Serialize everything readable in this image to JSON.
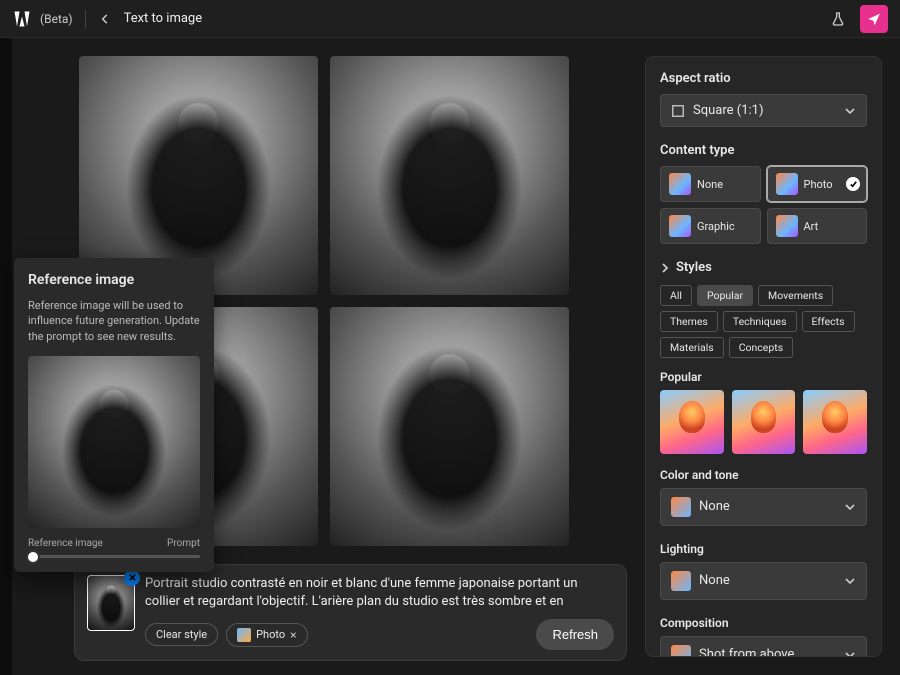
{
  "header": {
    "beta_label": "(Beta)",
    "title": "Text to image"
  },
  "popover": {
    "title": "Reference image",
    "description": "Reference image will be used to influence future generation. Update the prompt to see new results.",
    "slider_left": "Reference image",
    "slider_right": "Prompt"
  },
  "prompt": {
    "text": "Portrait studio contrasté en noir et blanc d'une femme japonaise portant un collier et regardant l'objectif. L'arière plan du studio est très sombre et en",
    "clear_style": "Clear style",
    "tag_label": "Photo",
    "refresh": "Refresh"
  },
  "panel": {
    "aspect_ratio": {
      "label": "Aspect ratio",
      "value": "Square (1:1)"
    },
    "content_type": {
      "label": "Content type",
      "options": [
        "None",
        "Photo",
        "Graphic",
        "Art"
      ],
      "selected": "Photo"
    },
    "styles": {
      "label": "Styles",
      "chips": [
        "All",
        "Popular",
        "Movements",
        "Themes",
        "Techniques",
        "Effects",
        "Materials",
        "Concepts"
      ],
      "active_chip": "Popular",
      "popular_label": "Popular"
    },
    "color_tone": {
      "label": "Color and tone",
      "value": "None"
    },
    "lighting": {
      "label": "Lighting",
      "value": "None"
    },
    "composition": {
      "label": "Composition",
      "value": "Shot from above"
    }
  }
}
